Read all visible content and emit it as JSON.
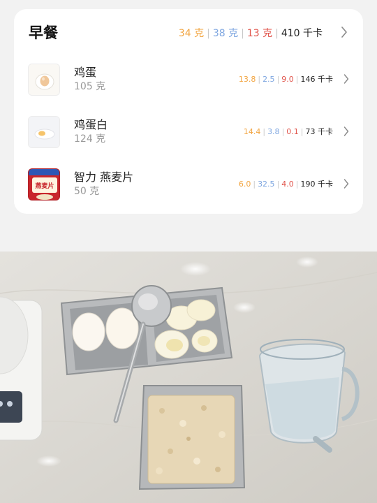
{
  "meal": {
    "title": "早餐",
    "totals": {
      "carbs": "34 克",
      "protein": "38 克",
      "fat": "13 克",
      "calories": "410 千卡"
    },
    "colors": {
      "carbs": "#f2a541",
      "protein": "#7ea6e0",
      "fat": "#e0534a"
    }
  },
  "items": [
    {
      "name": "鸡蛋",
      "amount": "105 克",
      "carbs": "13.8",
      "protein": "2.5",
      "fat": "9.0",
      "calories": "146 千卡",
      "icon": "boiled-egg-thumbnail"
    },
    {
      "name": "鸡蛋白",
      "amount": "124 克",
      "carbs": "14.4",
      "protein": "3.8",
      "fat": "0.1",
      "calories": "73 千卡",
      "icon": "egg-white-thumbnail"
    },
    {
      "name": "智力 燕麦片",
      "amount": "50 克",
      "carbs": "6.0",
      "protein": "32.5",
      "fat": "4.0",
      "calories": "190 千卡",
      "icon": "oatmeal-package-thumbnail",
      "package_text": "燕麦片"
    }
  ]
}
